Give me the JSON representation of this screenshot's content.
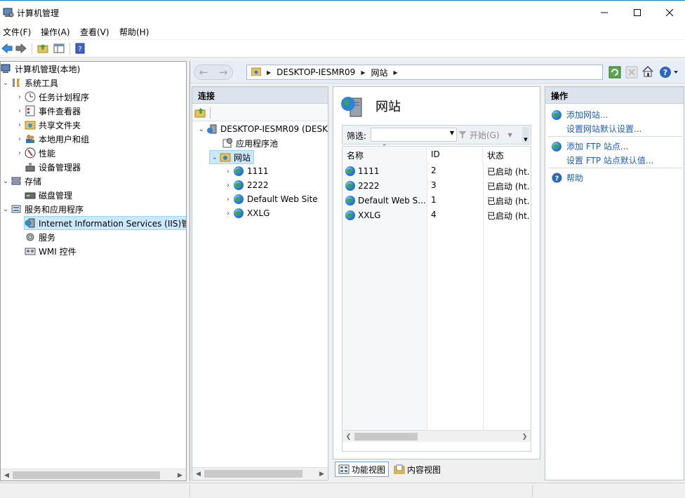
{
  "window": {
    "title": "计算机管理",
    "controls": {
      "minimize": "—",
      "maximize": "☐",
      "close": "✕"
    }
  },
  "menu": [
    "文件(F)",
    "操作(A)",
    "查看(V)",
    "帮助(H)"
  ],
  "tree": {
    "root": "计算机管理(本地)",
    "system_tools": "系统工具",
    "task_scheduler": "任务计划程序",
    "event_viewer": "事件查看器",
    "shared_folders": "共享文件夹",
    "local_users": "本地用户和组",
    "performance": "性能",
    "device_manager": "设备管理器",
    "storage": "存储",
    "disk_management": "磁盘管理",
    "services_apps": "服务和应用程序",
    "iis": "Internet Information Services (IIS)管",
    "services": "服务",
    "wmi": "WMI 控件"
  },
  "address": {
    "machine": "DESKTOP-IESMR09",
    "section": "网站"
  },
  "connections": {
    "header": "连接",
    "server": "DESKTOP-IESMR09 (DESK",
    "app_pools": "应用程序池",
    "sites": "网站",
    "site_items": [
      "1111",
      "2222",
      "Default Web Site",
      "XXLG"
    ]
  },
  "sites_pane": {
    "title": "网站",
    "filter_label": "筛选:",
    "go_label": "开始(G)",
    "columns": [
      "名称",
      "ID",
      "状态"
    ],
    "rows": [
      {
        "name": "1111",
        "id": "2",
        "status": "已启动 (ht..."
      },
      {
        "name": "2222",
        "id": "3",
        "status": "已启动 (ht..."
      },
      {
        "name": "Default Web S...",
        "id": "1",
        "status": "已启动 (ht..."
      },
      {
        "name": "XXLG",
        "id": "4",
        "status": "已启动 (ht..."
      }
    ],
    "tabs": {
      "features": "功能视图",
      "content": "内容视图"
    }
  },
  "actions": {
    "header": "操作",
    "add_site": "添加网站...",
    "site_defaults": "设置网站默认设置...",
    "add_ftp": "添加 FTP 站点...",
    "ftp_defaults": "设置 FTP 站点默认值...",
    "help": "帮助"
  },
  "colors": {
    "selection": "#cce8ff",
    "link": "#1e5fb5",
    "panel_header": "#dce3ec",
    "nav_bar": "#e7eef7"
  }
}
